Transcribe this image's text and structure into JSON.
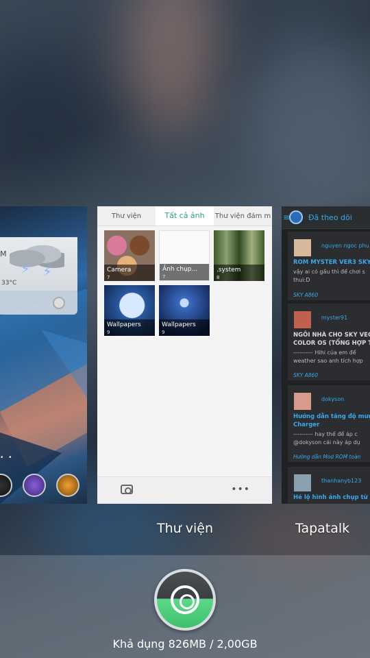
{
  "recents": {
    "home_card": {
      "weather_letter": "M",
      "weather_temp": "33°C"
    },
    "gallery_card": {
      "tabs": [
        "Thư viện",
        "Tất cả ảnh",
        "Thư viện đám m"
      ],
      "albums": [
        {
          "label": "Camera",
          "count": "7"
        },
        {
          "label": "Ảnh chụp...",
          "count": "7"
        },
        {
          "label": ".system",
          "count": "8"
        },
        {
          "label": "Wallpapers",
          "count": "9"
        },
        {
          "label": "Wallpapers",
          "count": "9"
        }
      ],
      "app_label": "Thư viện"
    },
    "tapatalk_card": {
      "header_title": "Đã theo dõi",
      "posts": [
        {
          "user": "nguyen ngoc phu",
          "title": "ROM MYSTER VER3 SKY",
          "body": "vậy ai có gấu thì để chơi s\nthui:D",
          "forum": "SKY A860"
        },
        {
          "user": "myster91",
          "title": "NGÔI NHÀ CHO SKY VEG\nCOLOR OS (TỔNG HỢP T",
          "body": "---------- Hihi của em để\nweather sao anh tích hợp",
          "forum": "SKY A860"
        },
        {
          "user": "dokyson",
          "title": "Hướng dẫn tăng độ mượt\nCharger",
          "body": "---------- hay thế để áp c\n@dokyson cái này áp dụ",
          "forum": "Hướng dẫn Mod ROM toàn"
        },
        {
          "user": "thanhanyb123",
          "title": "Hé lộ hình ảnh chụp từ Ca",
          "body": "----------",
          "forum": ""
        }
      ],
      "app_label": "Tapatalk"
    }
  },
  "memory": {
    "text": "Khả dụng 826MB / 2,00GB"
  },
  "colors": {
    "accent_green": "#29a37a",
    "tapatalk_blue": "#39a9e8"
  }
}
